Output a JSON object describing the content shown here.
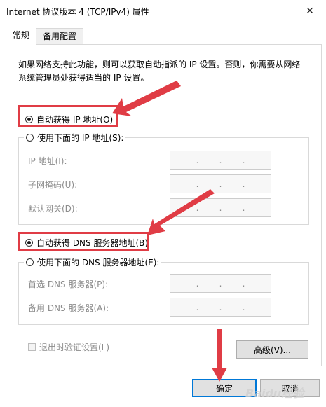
{
  "window": {
    "title": "Internet 协议版本 4 (TCP/IPv4) 属性",
    "close_glyph": "✕"
  },
  "tabs": [
    {
      "label": "常规",
      "active": true
    },
    {
      "label": "备用配置",
      "active": false
    }
  ],
  "description": "如果网络支持此功能，则可以获取自动指派的 IP 设置。否则，你需要从网络系统管理员处获得适当的 IP 设置。",
  "ip_section": {
    "auto_label": "自动获得 IP 地址(O)",
    "auto_selected": true,
    "manual_label": "使用下面的 IP 地址(S):",
    "manual_selected": false,
    "fields": [
      {
        "label": "IP 地址(I):",
        "value": ".       .       ."
      },
      {
        "label": "子网掩码(U):",
        "value": ".       .       ."
      },
      {
        "label": "默认网关(D):",
        "value": ".       .       ."
      }
    ]
  },
  "dns_section": {
    "auto_label": "自动获得 DNS 服务器地址(B)",
    "auto_selected": true,
    "manual_label": "使用下面的 DNS 服务器地址(E):",
    "manual_selected": false,
    "fields": [
      {
        "label": "首选 DNS 服务器(P):",
        "value": ".       .       ."
      },
      {
        "label": "备用 DNS 服务器(A):",
        "value": ".       .       ."
      }
    ]
  },
  "validate_on_exit": {
    "label": "退出时验证设置(L)",
    "checked": false
  },
  "buttons": {
    "advanced": "高级(V)...",
    "ok": "确定",
    "cancel": "取消"
  },
  "annotation_color": "#e03c45",
  "watermark": "Baidu经验"
}
